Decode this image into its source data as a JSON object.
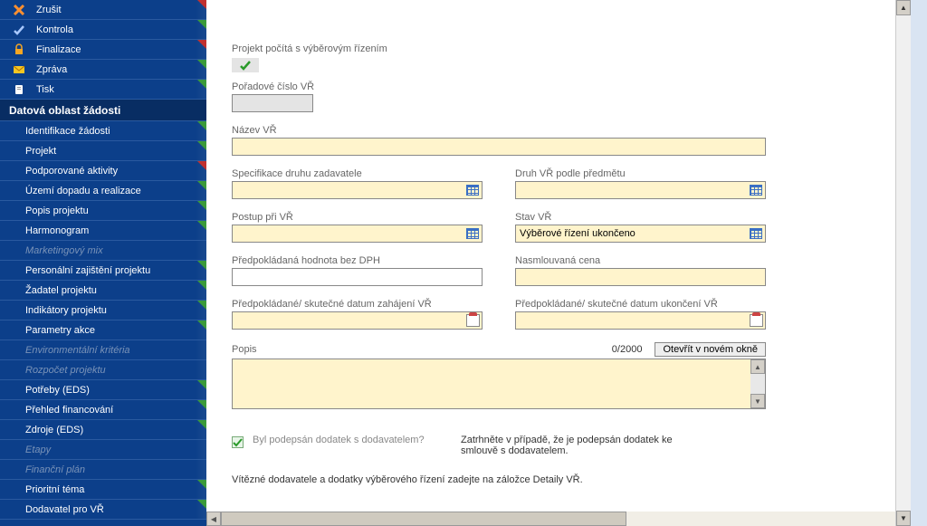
{
  "sidebar": {
    "top": [
      {
        "label": "Zrušit",
        "icon": "cancel",
        "corner": "red"
      },
      {
        "label": "Kontrola",
        "icon": "check",
        "corner": "green"
      },
      {
        "label": "Finalizace",
        "icon": "lock",
        "corner": "red"
      },
      {
        "label": "Zpráva",
        "icon": "mail",
        "corner": "green"
      },
      {
        "label": "Tisk",
        "icon": "print",
        "corner": "green"
      }
    ],
    "header": "Datová oblast žádosti",
    "items": [
      {
        "label": "Identifikace žádosti",
        "corner": "green"
      },
      {
        "label": "Projekt",
        "corner": "green"
      },
      {
        "label": "Podporované aktivity",
        "corner": "red"
      },
      {
        "label": "Území dopadu a realizace",
        "corner": "green"
      },
      {
        "label": "Popis projektu",
        "corner": "green"
      },
      {
        "label": "Harmonogram",
        "corner": "green"
      },
      {
        "label": "Marketingový mix",
        "dim": true
      },
      {
        "label": "Personální zajištění projektu",
        "corner": "green"
      },
      {
        "label": "Žadatel projektu",
        "corner": "green"
      },
      {
        "label": "Indikátory projektu",
        "corner": "green"
      },
      {
        "label": "Parametry akce",
        "corner": "green"
      },
      {
        "label": "Environmentální kritéria",
        "dim": true
      },
      {
        "label": "Rozpočet projektu",
        "dim": true
      },
      {
        "label": "Potřeby (EDS)",
        "corner": "green"
      },
      {
        "label": "Přehled financování",
        "corner": "green"
      },
      {
        "label": "Zdroje (EDS)",
        "corner": "green"
      },
      {
        "label": "Etapy",
        "dim": true
      },
      {
        "label": "Finanční plán",
        "dim": true
      },
      {
        "label": "Prioritní téma",
        "corner": "green"
      },
      {
        "label": "Dodavatel pro VŘ",
        "corner": "green"
      }
    ]
  },
  "form": {
    "projekt_pocita_label": "Projekt počítá s výběrovým řízením",
    "poradove_label": "Pořadové číslo VŘ",
    "nazev_label": "Název VŘ",
    "spec_label": "Specifikace druhu zadavatele",
    "druh_label": "Druh VŘ podle předmětu",
    "postup_label": "Postup při VŘ",
    "stav_label": "Stav VŘ",
    "stav_value": "Výběrové řízení ukončeno",
    "predp_hodnota_label": "Předpokládaná hodnota bez DPH",
    "nasml_cena_label": "Nasmlouvaná cena",
    "datum_zahaj_label": "Předpokládané/ skutečné datum zahájení VŘ",
    "datum_ukon_label": "Předpokládané/ skutečné datum ukončení VŘ",
    "popis_label": "Popis",
    "popis_counter": "0/2000",
    "open_btn": "Otevřít v novém okně",
    "dodatek_check_label": "Byl podepsán dodatek s dodavatelem?",
    "dodatek_desc": "Zatrhněte v případě, že je podepsán dodatek ke smlouvě s dodavatelem.",
    "note": "Vítězné dodavatele a dodatky výběrového řízení zadejte na záložce Detaily VŘ."
  }
}
